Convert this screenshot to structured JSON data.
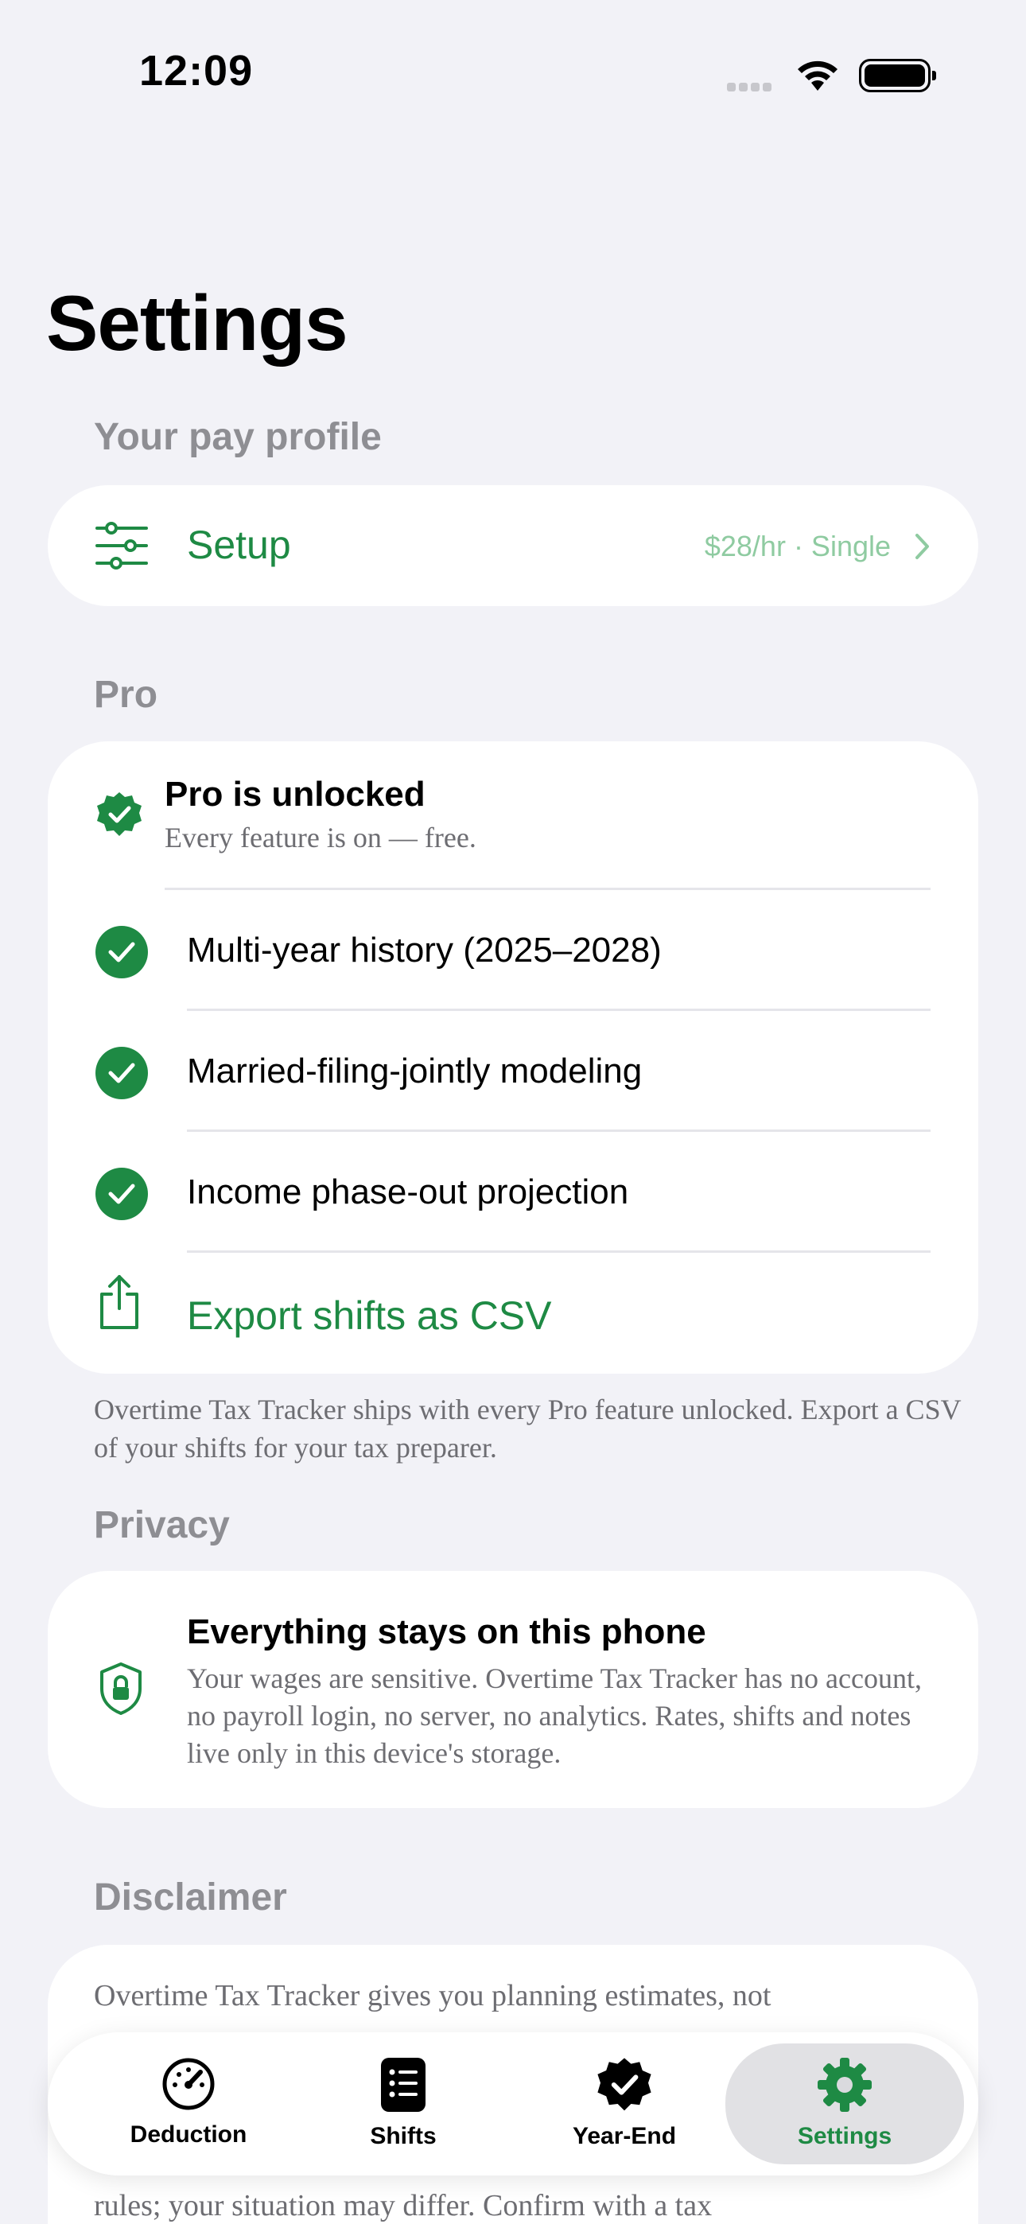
{
  "status_bar": {
    "time": "12:09"
  },
  "page": {
    "title": "Settings"
  },
  "pay_profile": {
    "header": "Your pay profile",
    "setup_label": "Setup",
    "setup_value": "$28/hr · Single"
  },
  "pro": {
    "header": "Pro",
    "unlocked_title": "Pro is unlocked",
    "unlocked_subtitle": "Every feature is on — free.",
    "features": [
      "Multi-year history (2025–2028)",
      "Married-filing-jointly modeling",
      "Income phase-out projection"
    ],
    "export_label": "Export shifts as CSV",
    "footnote": "Overtime Tax Tracker ships with every Pro feature unlocked. Export a CSV of your shifts for your tax preparer."
  },
  "privacy": {
    "header": "Privacy",
    "title": "Everything stays on this phone",
    "body": "Your wages are sensitive. Overtime Tax Tracker has no account, no payroll login, no server, no analytics. Rates, shifts and notes live only in this device's storage."
  },
  "disclaimer": {
    "header": "Disclaimer",
    "line1": "Overtime Tax Tracker gives you planning estimates, not",
    "line_last": "rules; your situation may differ. Confirm with a tax"
  },
  "tabs": [
    {
      "label": "Deduction",
      "icon": "gauge-icon"
    },
    {
      "label": "Shifts",
      "icon": "list-icon"
    },
    {
      "label": "Year-End",
      "icon": "checkmark-seal-icon"
    },
    {
      "label": "Settings",
      "icon": "gear-icon",
      "active": true
    }
  ],
  "colors": {
    "accent": "#1e8a44",
    "background": "#f2f2f7",
    "card": "#ffffff",
    "secondary_text": "#8e8e93"
  }
}
